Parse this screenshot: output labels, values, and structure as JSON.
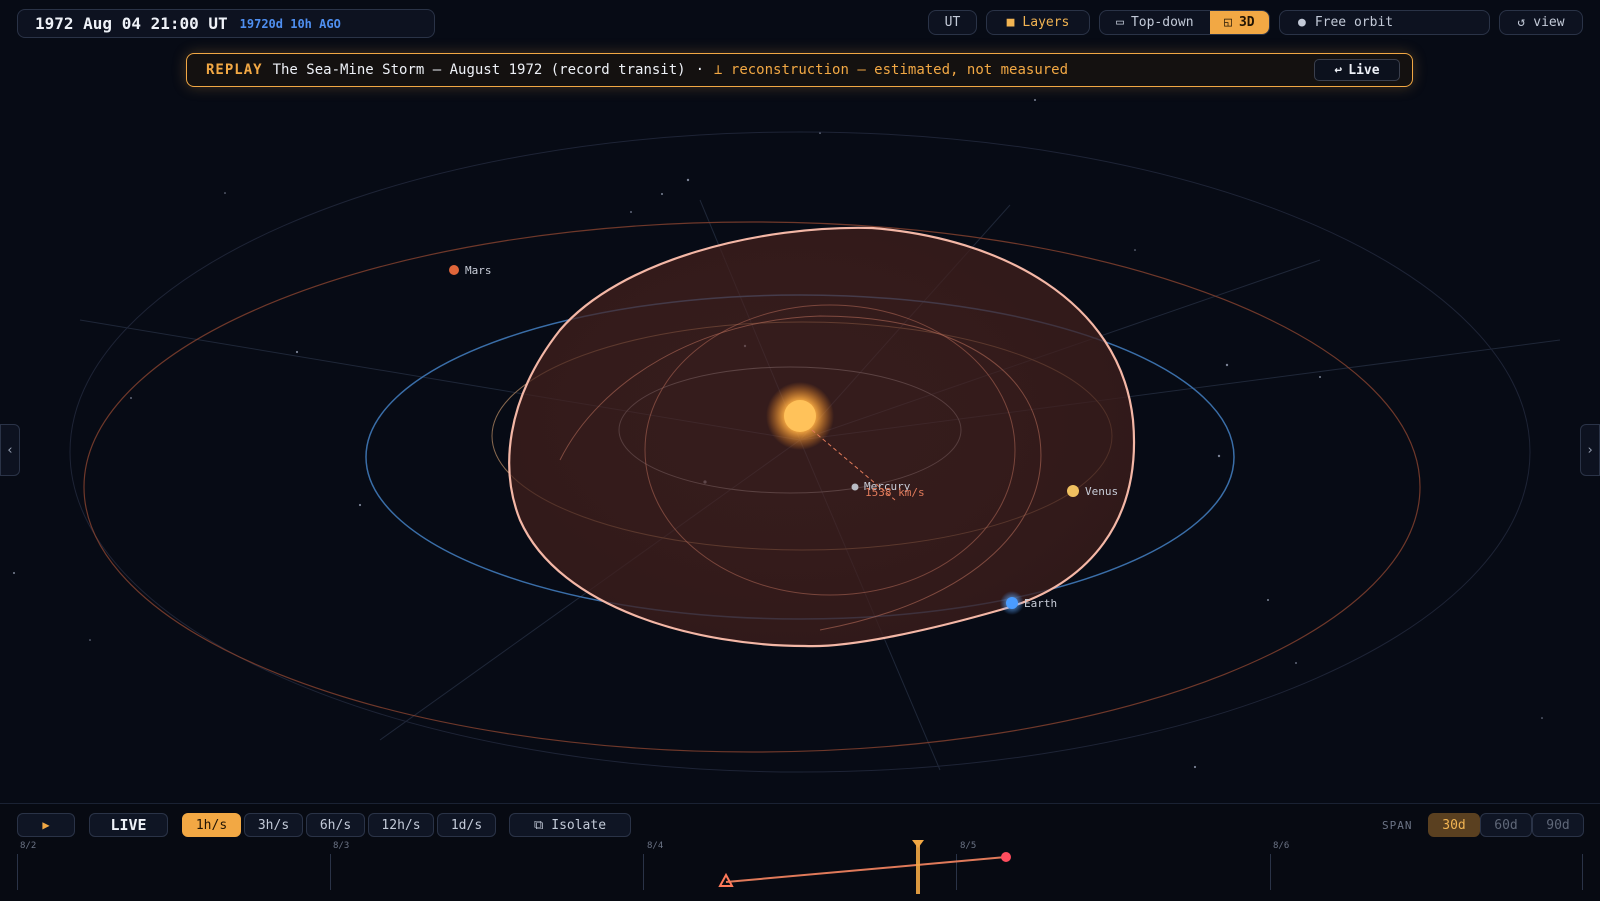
{
  "header": {
    "datetime": "1972 Aug 04 21:00 UT",
    "ago": "19720d 10h AGO",
    "ut_label": "UT",
    "layers_label": "Layers",
    "topdown_label": "Top-down",
    "threed_label": "3D",
    "orbit_label": "Free orbit",
    "reset_label": "view"
  },
  "banner": {
    "tag": "REPLAY",
    "title": "The Sea-Mine Storm — August 1972 (record transit)",
    "separator": "·",
    "warning": "⊥ reconstruction — estimated, not measured",
    "live_label": "Live"
  },
  "scene": {
    "planets": [
      {
        "name": "Mercury",
        "color": "#b9bcc4"
      },
      {
        "name": "Venus",
        "color": "#f0c060"
      },
      {
        "name": "Earth",
        "color": "#4a9cff"
      },
      {
        "name": "Mars",
        "color": "#e0663a"
      }
    ],
    "cme_speed": "1538 km/s",
    "sun_color": "#ffb347"
  },
  "controls": {
    "play_icon": "▶",
    "live_label": "LIVE",
    "rates": [
      "1h/s",
      "3h/s",
      "6h/s",
      "12h/s",
      "1d/s"
    ],
    "active_rate": "1h/s",
    "isolate_label": "Isolate",
    "span_label": "SPAN",
    "spans": [
      "30d",
      "60d",
      "90d"
    ],
    "active_span": "30d"
  },
  "timeline": {
    "ticks": [
      "8/2",
      "8/3",
      "8/4",
      "8/5",
      "8/6"
    ]
  },
  "colors": {
    "accent": "#f2a844",
    "cme": "#f4b0a0",
    "earth_orbit": "#3a6ea8"
  }
}
